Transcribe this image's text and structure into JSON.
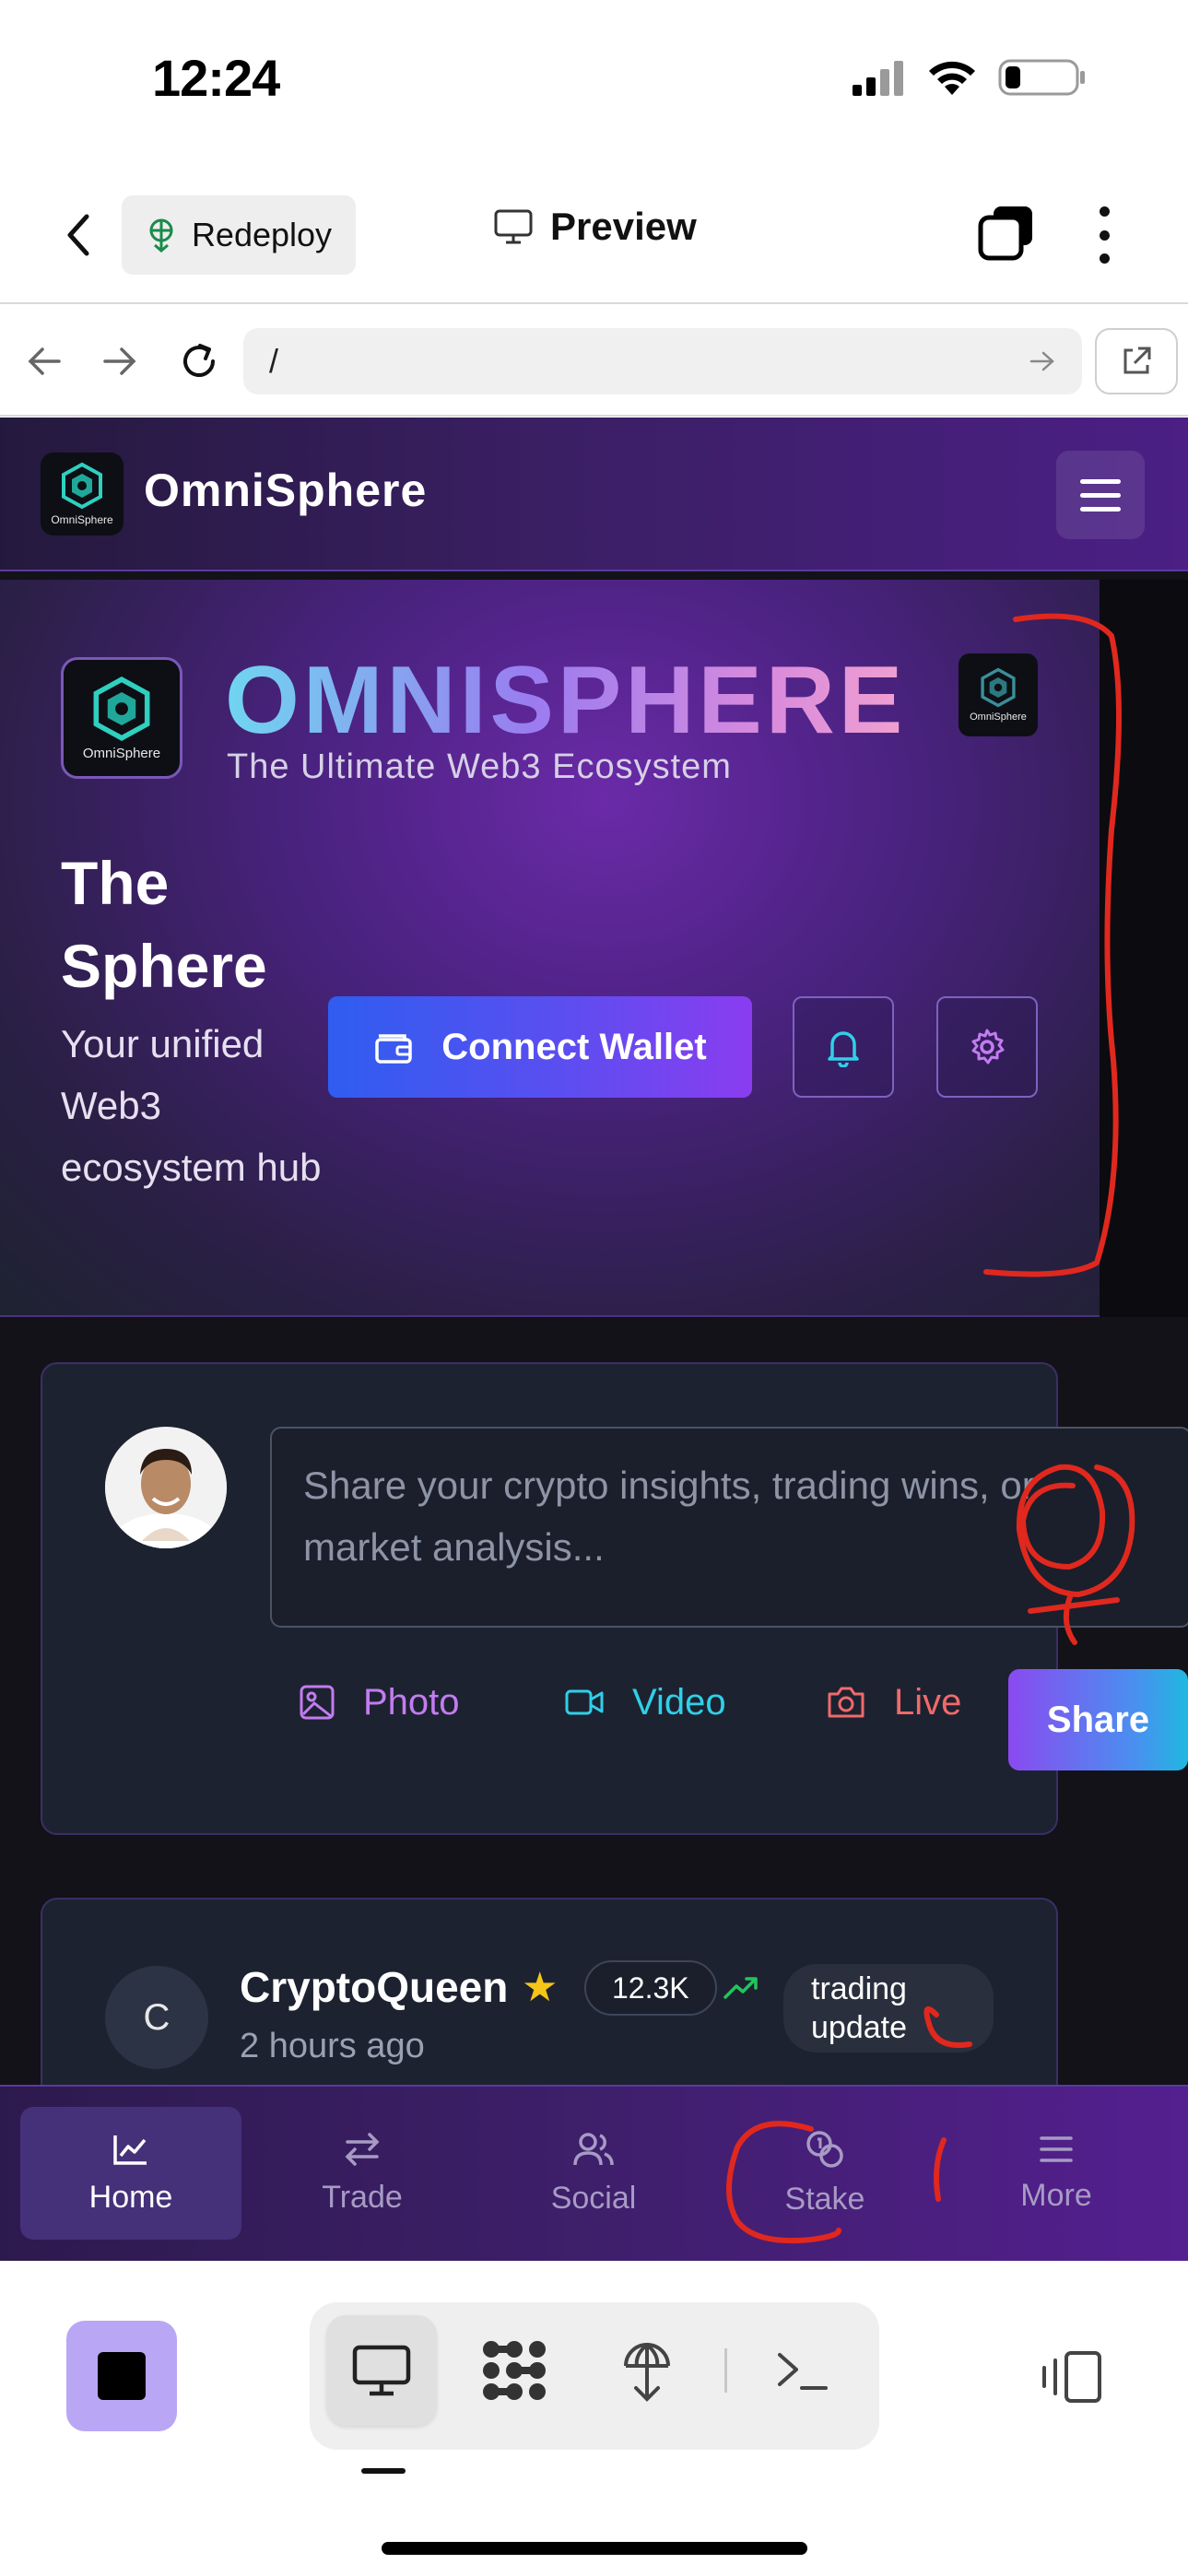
{
  "status_bar": {
    "time": "12:24"
  },
  "app_header": {
    "redeploy_label": "Redeploy",
    "preview_label": "Preview"
  },
  "url_bar": {
    "value": "/"
  },
  "site": {
    "name": "OmniSphere",
    "logo_text": "OmniSphere",
    "hero": {
      "brand": "OMNISPHERE",
      "tagline": "The Ultimate Web3 Ecosystem",
      "title": "The Sphere",
      "subtitle": "Your unified Web3 ecosystem hub",
      "connect_label": "Connect Wallet"
    },
    "composer": {
      "placeholder": "Share your crypto insights, trading wins, or market analysis...",
      "photo_label": "Photo",
      "video_label": "Video",
      "live_label": "Live",
      "share_label": "Share"
    },
    "feed": [
      {
        "avatar_initial": "C",
        "name": "CryptoQueen",
        "followers": "12.3K",
        "time": "2 hours ago",
        "tag_line1": "trading",
        "tag_line2": "update"
      }
    ],
    "bottom_nav": [
      {
        "label": "Home",
        "icon": "chart-line-icon",
        "active": true
      },
      {
        "label": "Trade",
        "icon": "arrows-swap-icon",
        "active": false
      },
      {
        "label": "Social",
        "icon": "users-icon",
        "active": false
      },
      {
        "label": "Stake",
        "icon": "coins-icon",
        "active": false
      },
      {
        "label": "More",
        "icon": "menu-icon",
        "active": false
      }
    ]
  },
  "colors": {
    "accent_purple": "#8a3df0",
    "accent_blue": "#2f5df0",
    "accent_cyan": "#20b8e0",
    "annotation_red": "#e0281e",
    "photo_color": "#c27cf0",
    "video_color": "#2fd0e8",
    "live_color": "#f06a6a"
  }
}
